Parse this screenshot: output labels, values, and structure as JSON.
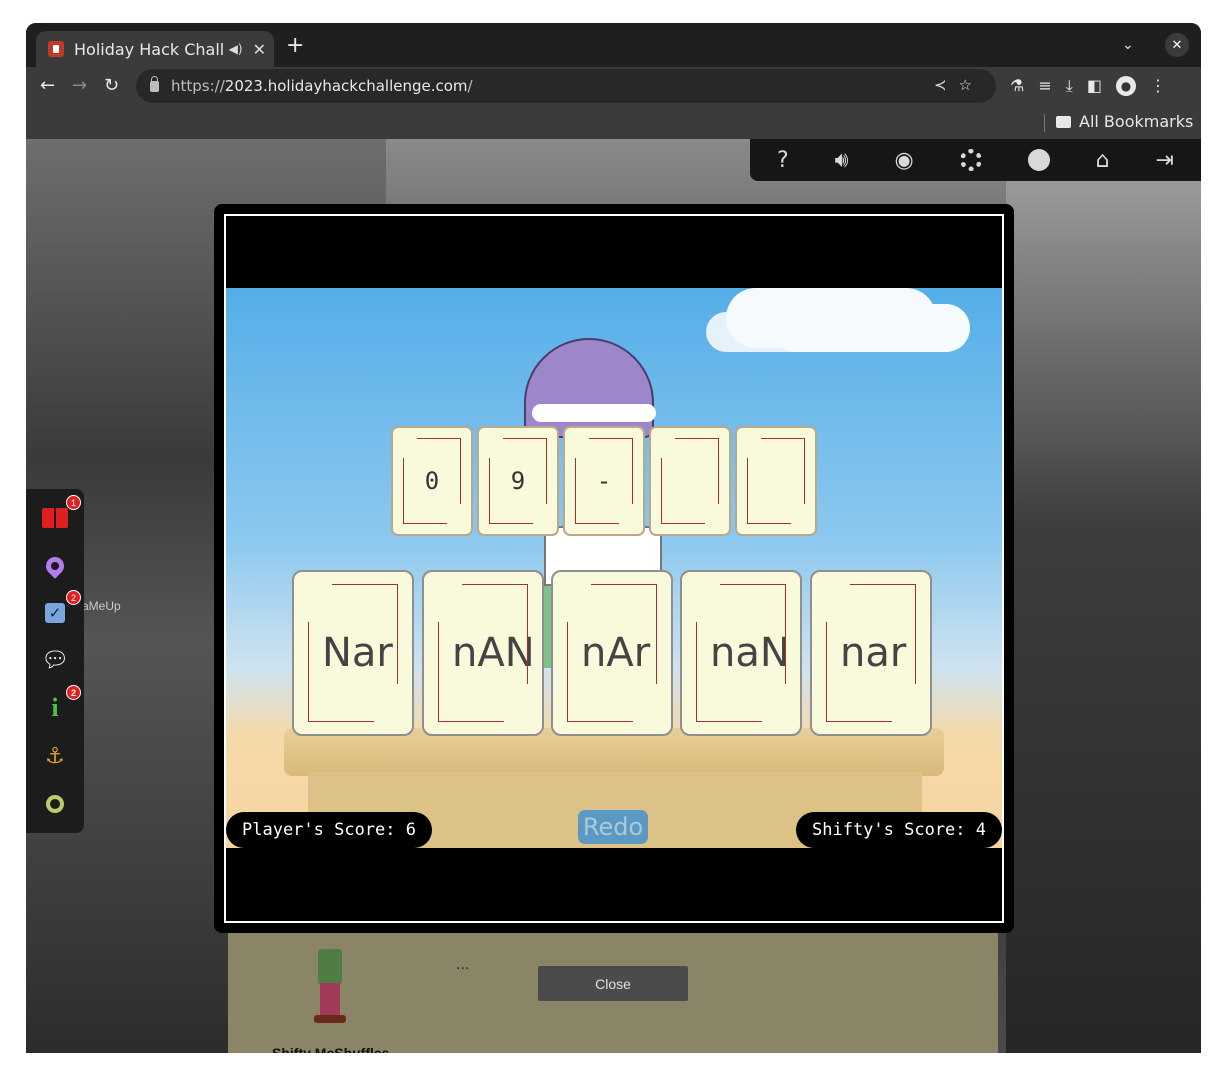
{
  "browser": {
    "tab_title": "Holiday Hack Challe",
    "url_scheme": "https://",
    "url_host": "2023.holidayhackchallenge.com",
    "url_path": "/",
    "bookmarks_label": "All Bookmarks"
  },
  "sidebar": {
    "badges": {
      "book": "1",
      "tasks": "2",
      "info": "2"
    }
  },
  "scene": {
    "label_gamemeup": "aMeUp",
    "npc_name": "Shifty McShuffles",
    "ellipsis": "...",
    "close_label": "Close"
  },
  "game": {
    "slots": [
      "0",
      "9",
      "-",
      "",
      ""
    ],
    "cards": [
      "Nar",
      "nAN",
      "nAr",
      "naN",
      "nar"
    ],
    "player_score": "Player's Score: 6",
    "shifty_score": "Shifty's Score: 4",
    "redo_label": "Redo"
  }
}
